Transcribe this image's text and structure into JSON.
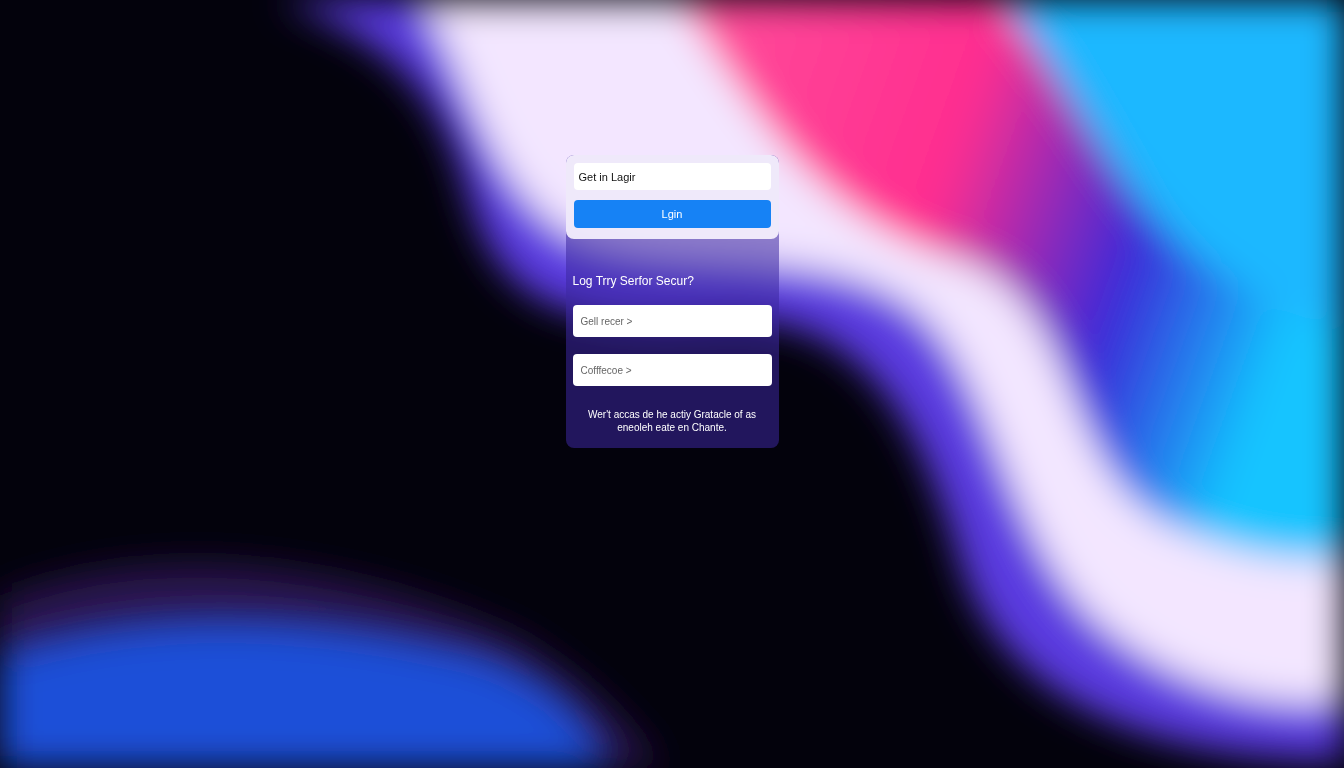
{
  "login_panel": {
    "field": {
      "value": "Get in Lagir"
    },
    "button": "Lgin"
  },
  "secure_panel": {
    "heading": "Log Trry Serfor Secur?",
    "fields": [
      {
        "placeholder": "Gell recer >"
      },
      {
        "placeholder": "Cofffecoe >"
      }
    ],
    "note": "Wer't accas de he actiy Gratacle of as eneoleh eate en Chante."
  }
}
